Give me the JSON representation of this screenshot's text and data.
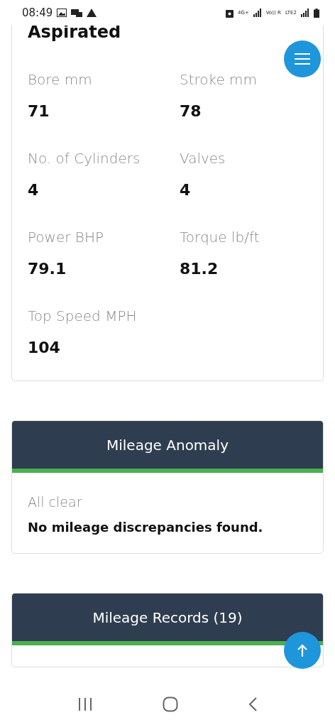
{
  "status_bar": {
    "time": "08:49",
    "network_labels": [
      "4G+",
      "Vo)) R",
      "LTE2"
    ]
  },
  "engine_card": {
    "title": "Aspirated",
    "specs": [
      {
        "label": "Bore mm",
        "value": "71"
      },
      {
        "label": "Stroke mm",
        "value": "78"
      },
      {
        "label": "No. of Cylinders",
        "value": "4"
      },
      {
        "label": "Valves",
        "value": "4"
      },
      {
        "label": "Power BHP",
        "value": "79.1"
      },
      {
        "label": "Torque lb/ft",
        "value": "81.2"
      },
      {
        "label": "Top Speed MPH",
        "value": "104"
      }
    ]
  },
  "anomaly_card": {
    "title": "Mileage Anomaly",
    "status": "All clear",
    "message": "No mileage discrepancies found."
  },
  "records_card": {
    "title": "Mileage Records (19)"
  }
}
